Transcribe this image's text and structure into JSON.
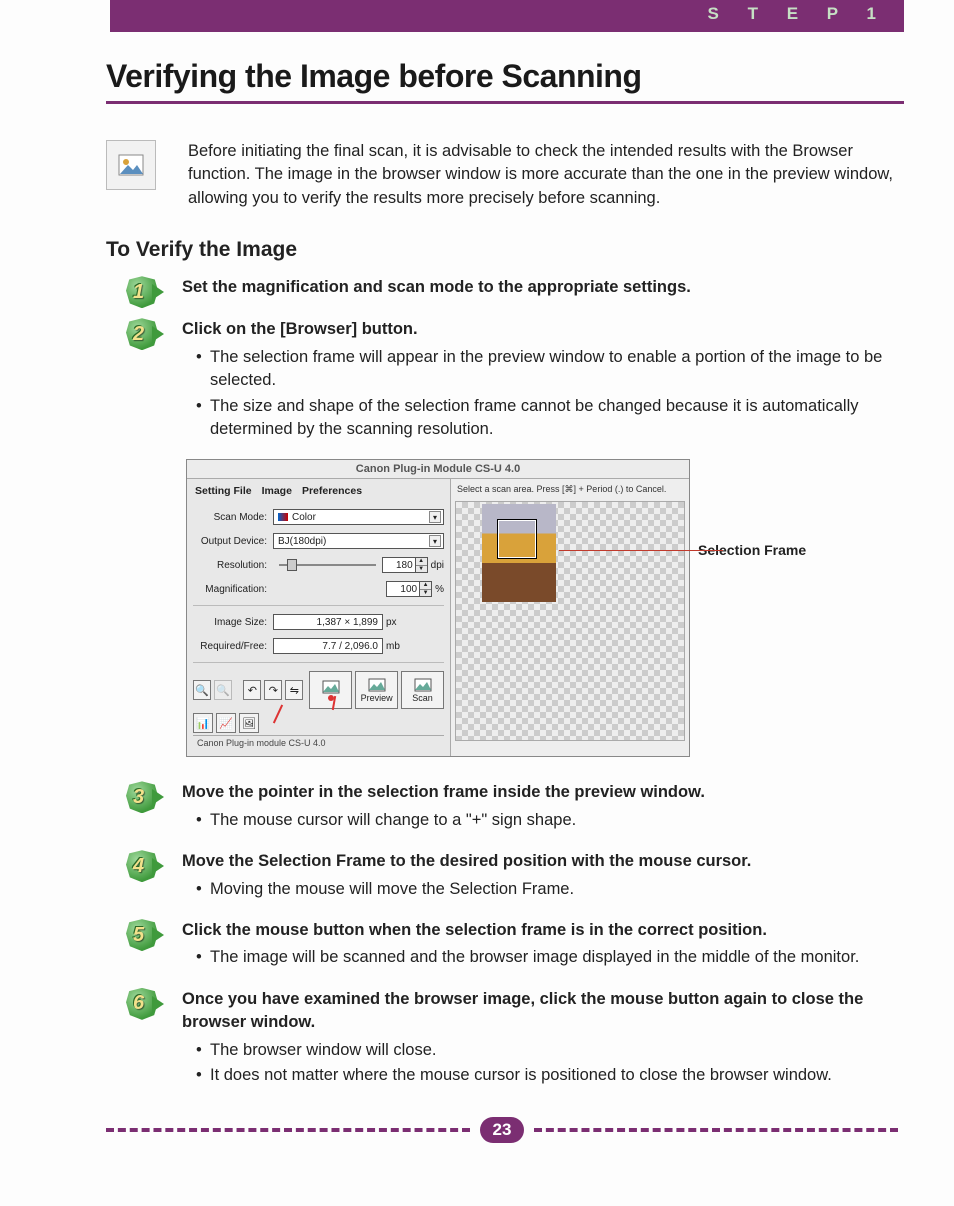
{
  "header": {
    "step_label": "S T E P   1",
    "title": "Verifying the Image before Scanning"
  },
  "intro": {
    "text": "Before initiating the final scan, it is advisable to check the intended results with the Browser function. The image in the browser window is more accurate than the one in the preview window, allowing you to verify the results more precisely before scanning."
  },
  "section_heading": "To Verify the Image",
  "steps": [
    {
      "num": "1",
      "title": "Set the magnification and scan mode to the appropriate settings.",
      "bullets": []
    },
    {
      "num": "2",
      "title": "Click on the [Browser] button.",
      "bullets": [
        "The selection frame will appear in the preview window to enable a portion of the image to be selected.",
        "The size and shape of the selection frame cannot be changed because it is automatically determined by the scanning resolution."
      ]
    },
    {
      "num": "3",
      "title": "Move the pointer in the selection frame inside the preview window.",
      "bullets": [
        "The mouse cursor will change to a \"+\" sign shape."
      ]
    },
    {
      "num": "4",
      "title": "Move the Selection Frame to the desired position with the mouse cursor.",
      "bullets": [
        "Moving the mouse will move the Selection Frame."
      ]
    },
    {
      "num": "5",
      "title": "Click the mouse button when the selection frame is in the correct position.",
      "bullets": [
        "The image will be scanned and the browser image displayed in the middle of the monitor."
      ]
    },
    {
      "num": "6",
      "title": "Once you have examined the browser image, click the mouse button again to close the browser window.",
      "bullets": [
        "The browser window will close.",
        "It does not matter where the mouse cursor is positioned to close the browser window."
      ]
    }
  ],
  "screenshot": {
    "window_title": "Canon Plug-in Module CS-U 4.0",
    "menus": [
      "Setting File",
      "Image",
      "Preferences"
    ],
    "prompt": "Select a scan area. Press [⌘] + Period (.) to Cancel.",
    "fields": {
      "scan_mode_label": "Scan Mode:",
      "scan_mode_value": "Color",
      "output_device_label": "Output Device:",
      "output_device_value": "BJ(180dpi)",
      "resolution_label": "Resolution:",
      "resolution_value": "180",
      "resolution_unit": "dpi",
      "magnification_label": "Magnification:",
      "magnification_value": "100",
      "magnification_unit": "%",
      "image_size_label": "Image Size:",
      "image_size_value": "1,387 × 1,899",
      "image_size_unit": "px",
      "required_free_label": "Required/Free:",
      "required_free_value": "7.7 / 2,096.0",
      "required_free_unit": "mb"
    },
    "buttons": {
      "preview": "Preview",
      "scan": "Scan"
    },
    "status": "Canon Plug-in module CS-U 4.0",
    "callout": "Selection Frame"
  },
  "page_number": "23"
}
